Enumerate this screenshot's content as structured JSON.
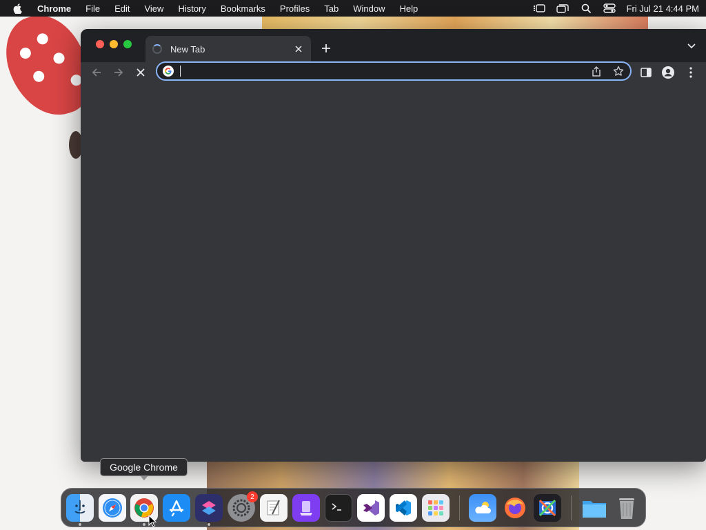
{
  "menubar": {
    "app_name": "Chrome",
    "items": [
      "File",
      "Edit",
      "View",
      "History",
      "Bookmarks",
      "Profiles",
      "Tab",
      "Window",
      "Help"
    ],
    "clock": "Fri Jul 21  4:44 PM"
  },
  "browser": {
    "tab_title": "New Tab",
    "omnibox_value": "",
    "accent_color": "#8ab4f8",
    "frame_color": "#202124",
    "content_color": "#35363a"
  },
  "tooltip": "Google Chrome",
  "dock": {
    "items": [
      "Finder",
      "Safari",
      "Google Chrome",
      "App Store",
      "Shortcuts",
      "System Settings",
      "Script Editor",
      "Simulator",
      "Terminal",
      "Visual Studio",
      "Visual Studio Code",
      "Launchpad",
      "Weather",
      "Firefox",
      "Instruments",
      "Downloads",
      "Trash"
    ],
    "settings_badge": "2"
  }
}
